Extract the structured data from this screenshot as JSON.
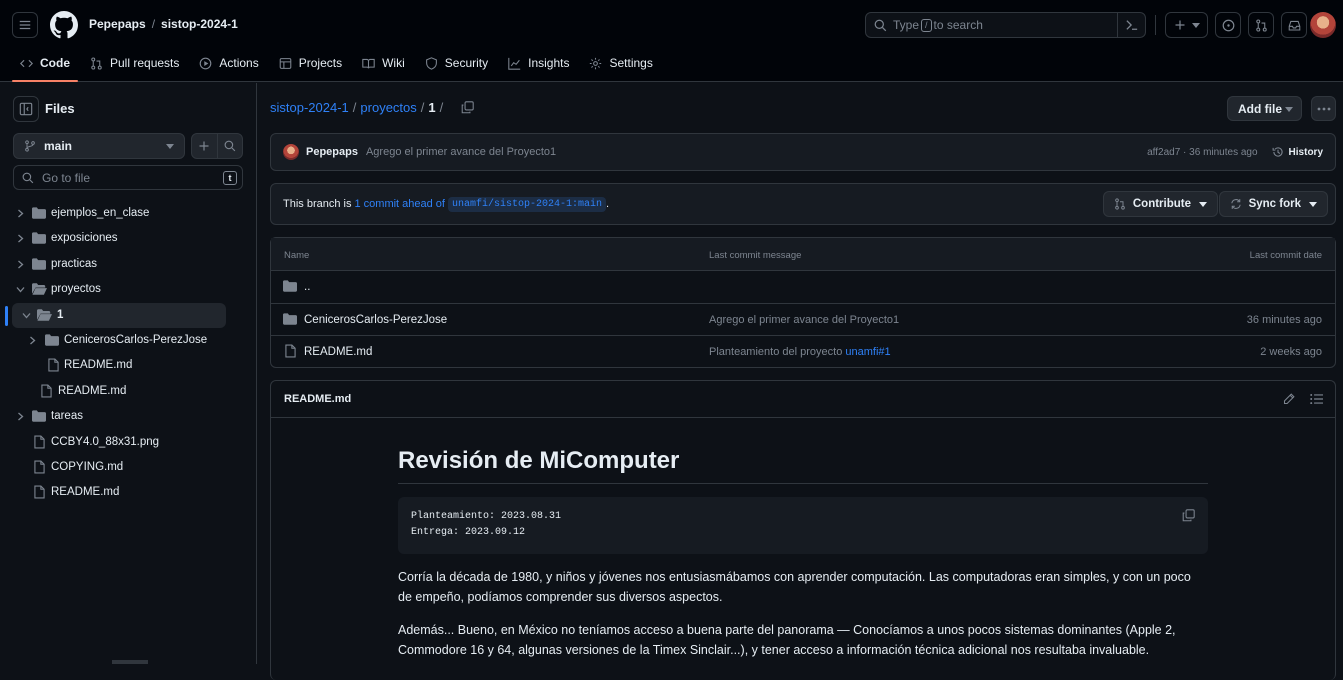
{
  "header": {
    "owner": "Pepepaps",
    "repo": "sistop-2024-1",
    "search_placeholder_pre": "Type",
    "search_key": "/",
    "search_placeholder_post": "to search"
  },
  "tabs": [
    {
      "label": "Code",
      "icon": "code-icon"
    },
    {
      "label": "Pull requests",
      "icon": "pull-request-icon"
    },
    {
      "label": "Actions",
      "icon": "play-icon"
    },
    {
      "label": "Projects",
      "icon": "table-icon"
    },
    {
      "label": "Wiki",
      "icon": "book-icon"
    },
    {
      "label": "Security",
      "icon": "shield-icon"
    },
    {
      "label": "Insights",
      "icon": "graph-icon"
    },
    {
      "label": "Settings",
      "icon": "gear-icon"
    }
  ],
  "sidebar": {
    "title": "Files",
    "branch": "main",
    "goto_placeholder": "Go to file",
    "goto_key": "t",
    "tree": [
      {
        "label": "ejemplos_en_clase",
        "type": "folder"
      },
      {
        "label": "exposiciones",
        "type": "folder"
      },
      {
        "label": "practicas",
        "type": "folder"
      },
      {
        "label": "proyectos",
        "type": "folder-open"
      },
      {
        "label": "1",
        "type": "folder-open"
      },
      {
        "label": "CenicerosCarlos-PerezJose",
        "type": "folder"
      },
      {
        "label": "README.md",
        "type": "file"
      },
      {
        "label": "README.md",
        "type": "file"
      },
      {
        "label": "tareas",
        "type": "folder"
      },
      {
        "label": "CCBY4.0_88x31.png",
        "type": "file"
      },
      {
        "label": "COPYING.md",
        "type": "file"
      },
      {
        "label": "README.md",
        "type": "file"
      }
    ]
  },
  "path": {
    "repo": "sistop-2024-1",
    "folder": "proyectos",
    "current": "1"
  },
  "actions": {
    "add_file": "Add file"
  },
  "commit": {
    "author": "Pepepaps",
    "message": "Agrego el primer avance del Proyecto1",
    "meta": "aff2ad7 · 36 minutes ago",
    "history": "History"
  },
  "branch_status": {
    "pre": "This branch is",
    "link": "1 commit ahead of",
    "ref": "unamfi/sistop-2024-1:main",
    "post": ".",
    "contribute": "Contribute",
    "sync": "Sync fork"
  },
  "file_table": {
    "headers": {
      "name": "Name",
      "message": "Last commit message",
      "date": "Last commit date"
    },
    "parent": "..",
    "rows": [
      {
        "name": "CenicerosCarlos-PerezJose",
        "type": "folder",
        "message": "Agrego el primer avance del Proyecto1",
        "message_link": "",
        "date": "36 minutes ago"
      },
      {
        "name": "README.md",
        "type": "file",
        "message": "Planteamiento del proyecto",
        "message_link": "unamfi#1",
        "date": "2 weeks ago"
      }
    ]
  },
  "readme": {
    "filename": "README.md",
    "title": "Revisión de MiComputer",
    "code_line1": "Planteamiento: 2023.08.31",
    "code_line2": "Entrega: 2023.09.12",
    "para1": "Corría la década de 1980, y niños y jóvenes nos entusiasmábamos con aprender computación. Las computadoras eran simples, y con un poco de empeño, podíamos comprender sus diversos aspectos.",
    "para2": "Además... Bueno, en México no teníamos acceso a buena parte del panorama — Conocíamos a unos pocos sistemas dominantes (Apple 2, Commodore 16 y 64, algunas versiones de la Timex Sinclair...), y tener acceso a información técnica adicional nos resultaba invaluable."
  },
  "colors": {
    "accent": "#2f81f7",
    "tab_underline": "#f78166",
    "bg": "#0d1117",
    "header_bg": "#010409",
    "border": "#30363d",
    "muted": "#7d8590"
  }
}
